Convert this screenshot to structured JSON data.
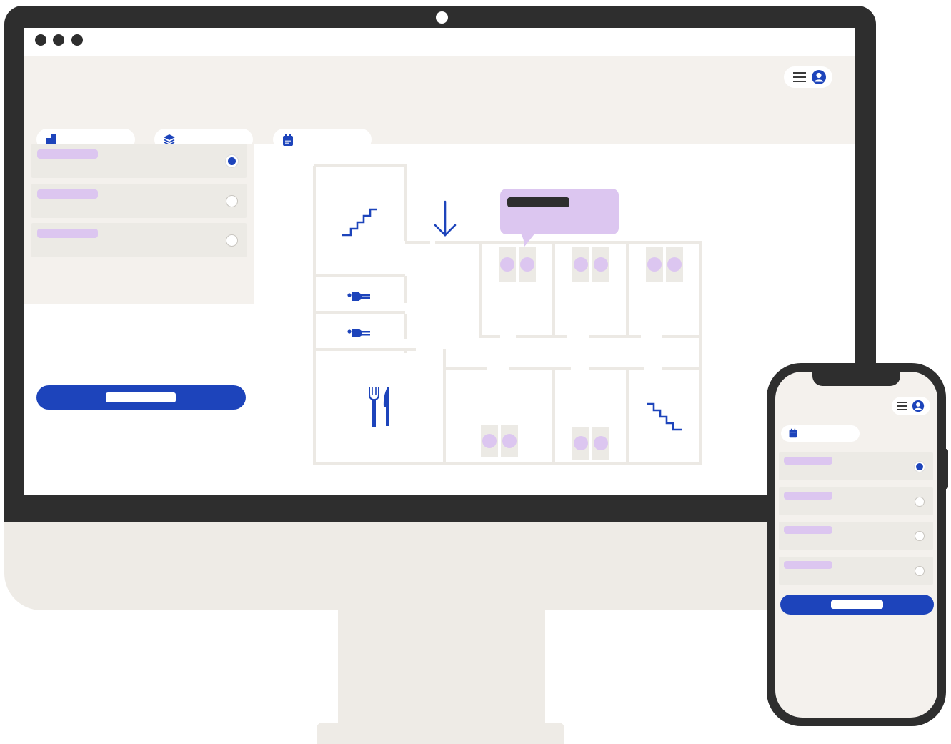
{
  "desktop": {
    "window_controls": [
      "close",
      "minimize",
      "maximize"
    ],
    "header": {
      "menu_icon": "hamburger-icon",
      "account_icon": "user-avatar-icon",
      "filters": [
        {
          "icon": "building-icon"
        },
        {
          "icon": "layers-icon"
        },
        {
          "icon": "calendar-icon"
        }
      ]
    },
    "sidebar": {
      "rooms": [
        {
          "selected": true
        },
        {
          "selected": false
        },
        {
          "selected": false
        }
      ]
    },
    "floor_plan": {
      "icons": [
        "stairs-up-icon",
        "arrow-down-icon",
        "restroom-icon",
        "restroom-icon",
        "restaurant-icon",
        "stairs-down-icon"
      ],
      "callout": true
    }
  },
  "phone": {
    "header": {
      "menu_icon": "hamburger-icon",
      "account_icon": "user-avatar-icon"
    },
    "filters": [
      {
        "icon": "calendar-icon"
      }
    ],
    "rooms": [
      {
        "selected": true
      },
      {
        "selected": false
      },
      {
        "selected": false
      },
      {
        "selected": false
      }
    ]
  },
  "colors": {
    "accent": "#1d44bb",
    "lavender": "#dcc6f0",
    "device_dark": "#2e2e2e",
    "panel_beige": "#f4f1ed",
    "wall_lines": "#ece9e4"
  }
}
